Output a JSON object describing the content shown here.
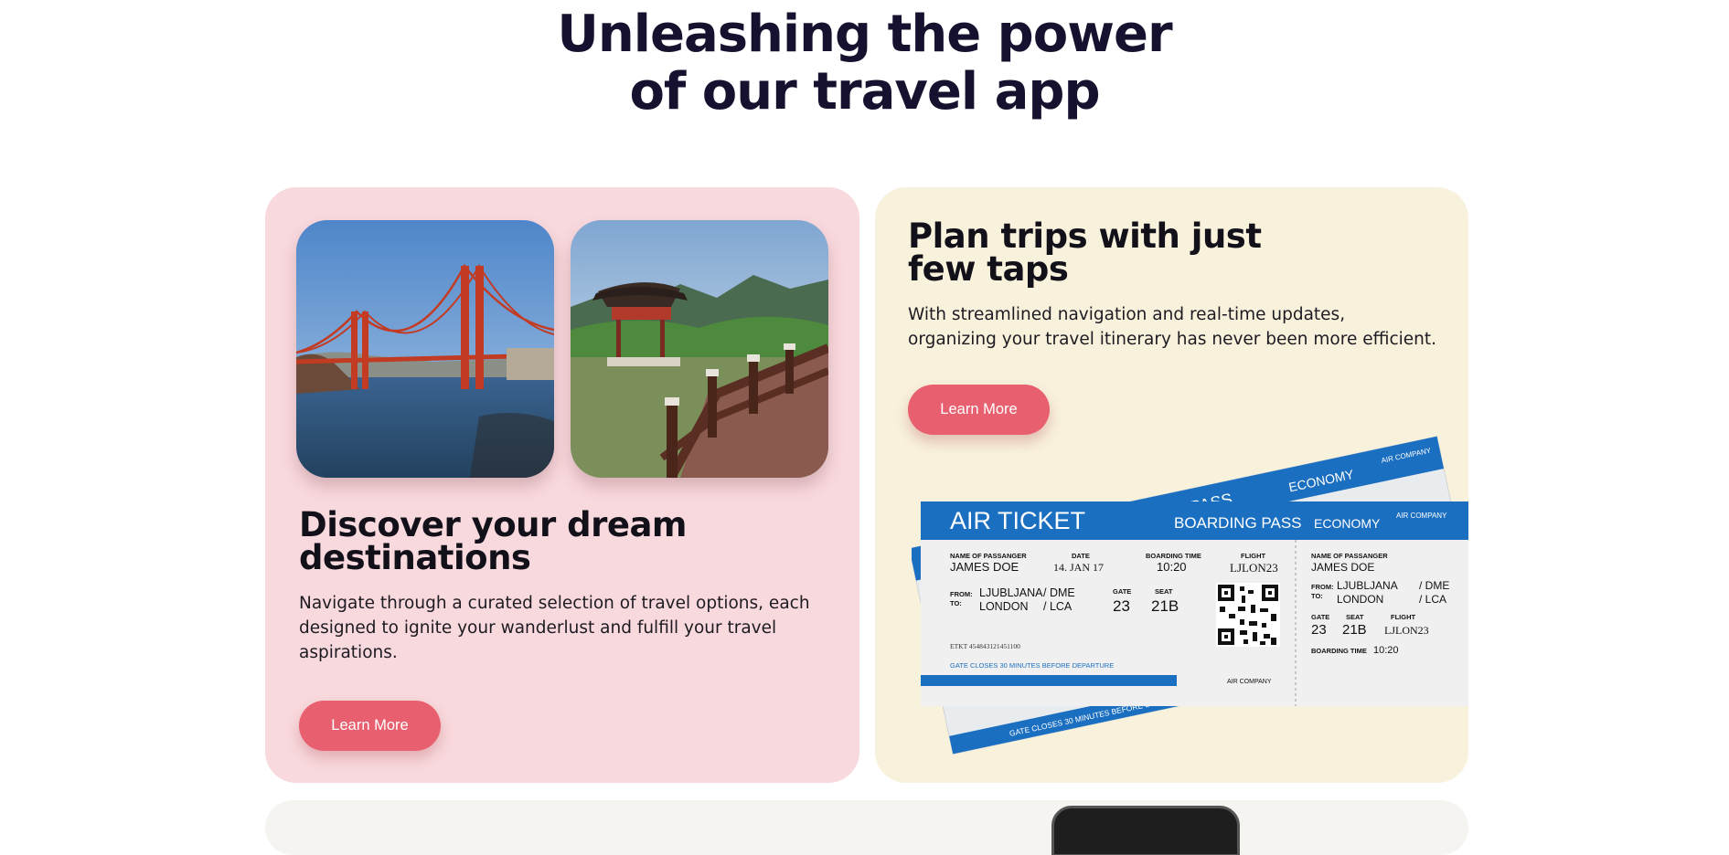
{
  "headline": {
    "line1": "Unleashing the power",
    "line2": "of our travel app"
  },
  "discover_card": {
    "title_line1": "Discover your dream",
    "title_line2": "destinations",
    "body_lines": [
      "Navigate through a curated selection of travel options, each",
      "designed to ignite your wanderlust and fulfill your travel",
      "aspirations."
    ],
    "button_label": "Learn More",
    "photos": [
      "golden-gate-bridge-photo",
      "korean-pavilion-photo"
    ]
  },
  "plan_card": {
    "title_line1": "Plan trips with just",
    "title_line2": "few taps",
    "body_lines": [
      "With streamlined navigation and real-time updates,",
      "organizing your travel itinerary has never been more efficient."
    ],
    "button_label": "Learn More"
  },
  "ticket": {
    "title": "AIR TICKET",
    "boarding_pass": "BOARDING PASS",
    "back_pass": "PASS",
    "economy": "ECONOMY",
    "air_company": "AIR COMPANY",
    "labels": {
      "name": "NAME OF PASSANGER",
      "date": "DATE",
      "boarding_time": "BOARDING TIME",
      "flight": "FLIGHT",
      "from": "FROM:",
      "to": "TO:",
      "gate": "GATE",
      "seat": "SEAT"
    },
    "passenger": "JAMES DOE",
    "date": "14. JAN 17",
    "boarding_time": "10:20",
    "flight": "LJLON23",
    "from_city": "LJUBLJANA",
    "from_code": "/ DME",
    "to_city": "LONDON",
    "to_code": "/ LCA",
    "gate": "23",
    "seat": "21B",
    "etkt": "ETKT 454843121451100",
    "gate_closes": "GATE CLOSES 30 MINUTES BEFORE DEPARTURE",
    "back_gate_closes": "GATE CLOSES 30 MINUTES BEFORE DEPARTURE"
  },
  "colors": {
    "headline": "#15112e",
    "pink_card": "#f8d9dd",
    "cream_card": "#f8f1dc",
    "button": "#e8606f",
    "ticket_blue": "#1b6fc0"
  }
}
